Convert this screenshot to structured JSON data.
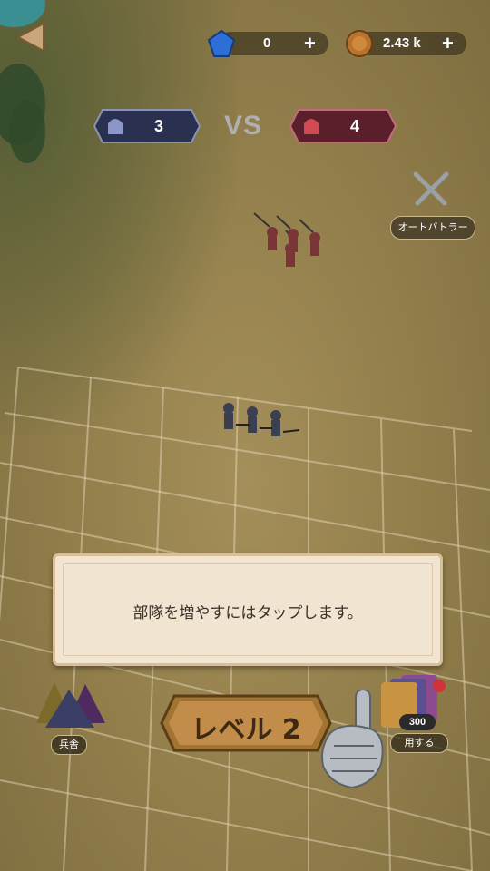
{
  "header": {
    "back_icon": "back-arrow-icon",
    "gems": {
      "icon": "gem-icon",
      "value": "0",
      "add": "+"
    },
    "coins": {
      "icon": "coin-icon",
      "value": "2.43 k",
      "add": "+"
    }
  },
  "versus": {
    "player": {
      "icon": "blue-helmet-icon",
      "count": "3",
      "color": "#2a3150"
    },
    "vs_label": "VS",
    "enemy": {
      "icon": "red-helmet-icon",
      "count": "4",
      "color": "#5a1f2a"
    }
  },
  "auto_battle": {
    "icon": "crossed-swords-icon",
    "label": "オートバトラー"
  },
  "tutorial": {
    "message": "部隊を増やすにはタップします。"
  },
  "level_button": {
    "label": "レベル",
    "number": "2"
  },
  "barracks": {
    "icon": "tent-icon",
    "label": "兵舎"
  },
  "deploy": {
    "icon": "card-deck-icon",
    "cost": "300",
    "label": "用する",
    "notification_color": "#d0333c"
  },
  "hint": {
    "icon": "gauntlet-pointer-icon"
  }
}
